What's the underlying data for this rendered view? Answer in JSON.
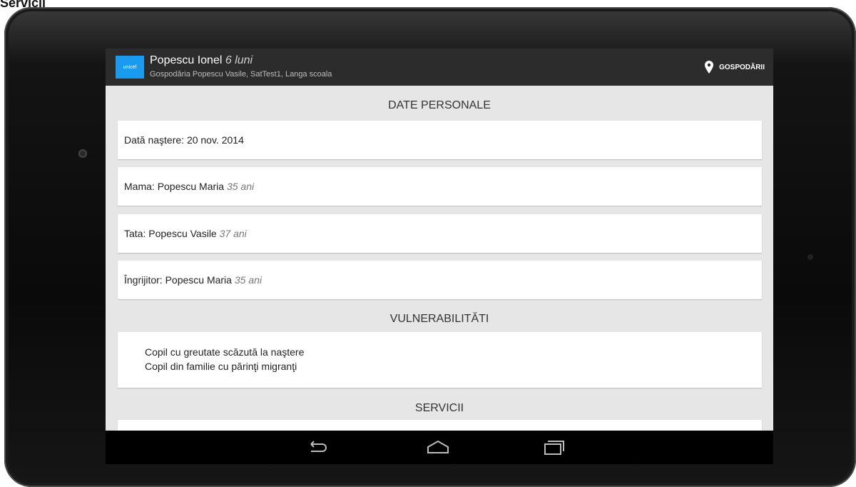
{
  "caption": "Servicii",
  "actionbar": {
    "logo_text": "unicef",
    "title_name": "Popescu Ionel",
    "title_age": "6 luni",
    "subtitle": "Gospodăria Popescu Vasile, SatTest1, Langa scoala",
    "action_label": "GOSPODĂRII",
    "action_icon": "map-pin-icon"
  },
  "sections": {
    "personal_header": "DATE PERSONALE",
    "vuln_header": "VULNERABILITĂTI",
    "services_header": "SERVICII"
  },
  "personal": {
    "birth_label": "Dată naştere: 20 nov. 2014",
    "mother_label": "Mama:",
    "mother_name": "Popescu Maria",
    "mother_age": "35 ani",
    "father_label": "Tata:",
    "father_name": "Popescu Vasile",
    "father_age": "37 ani",
    "caregiver_label": "Îngrijitor:",
    "caregiver_name": "Popescu Maria",
    "caregiver_age": "35 ani"
  },
  "vulnerabilities": [
    "Copil cu greutate scăzută la naştere",
    "Copil din familie cu părinţi migranţi"
  ],
  "navbar": {
    "back": "back-icon",
    "home": "home-icon",
    "recents": "recents-icon"
  },
  "colors": {
    "logo_blue": "#1a9bf0",
    "actionbar": "#2c2c2c",
    "screen_bg": "#e6e6e6"
  }
}
